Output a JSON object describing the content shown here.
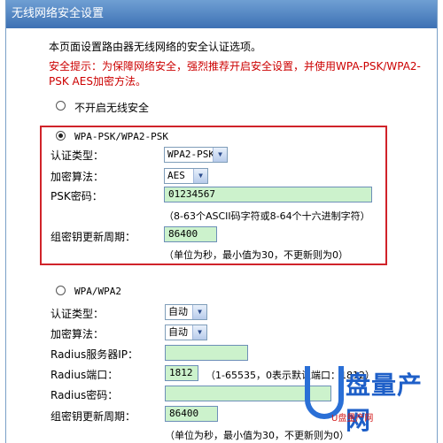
{
  "page": {
    "title": "无线网络安全设置",
    "description": "本页面设置路由器无线网络的安全认证选项。",
    "warning_line1": "安全提示：为保障网络安全，强烈推荐开启安全设置，并使用WPA-PSK/WPA2-",
    "warning_line2": "PSK AES加密方法。"
  },
  "no_security": {
    "label": "不开启无线安全",
    "selected": false
  },
  "wpa_psk": {
    "label": "WPA-PSK/WPA2-PSK",
    "selected": true,
    "auth_type_label": "认证类型：",
    "auth_type_value": "WPA2-PSK",
    "encryption_label": "加密算法：",
    "encryption_value": "AES",
    "psk_label": "PSK密码：",
    "psk_value": "01234567",
    "psk_hint": "（8-63个ASCII码字符或8-64个十六进制字符）",
    "renew_label": "组密钥更新周期：",
    "renew_value": "86400",
    "renew_hint": "（单位为秒，最小值为30，不更新则为0）",
    "highlight_color": "#d0232a"
  },
  "wpa": {
    "label": "WPA/WPA2",
    "selected": false,
    "auth_type_label": "认证类型：",
    "auth_type_value": "自动",
    "encryption_label": "加密算法：",
    "encryption_value": "自动",
    "radius_ip_label": "Radius服务器IP：",
    "radius_ip_value": "",
    "radius_port_label": "Radius端口：",
    "radius_port_value": "1812",
    "radius_port_hint": "（1-65535，0表示默认端口：1812）",
    "radius_password_label": "Radius密码：",
    "radius_password_value": "",
    "renew_label": "组密钥更新周期：",
    "renew_value": "86400",
    "renew_hint": "（单位为秒，最小值为30，不更新则为0）"
  },
  "watermark": {
    "brand": "盘量产网",
    "sub": "U盘量产网"
  },
  "colors": {
    "title_bar": "#3d71b4",
    "input_fill": "#ccf2cc",
    "warning_text": "#cc0000"
  }
}
